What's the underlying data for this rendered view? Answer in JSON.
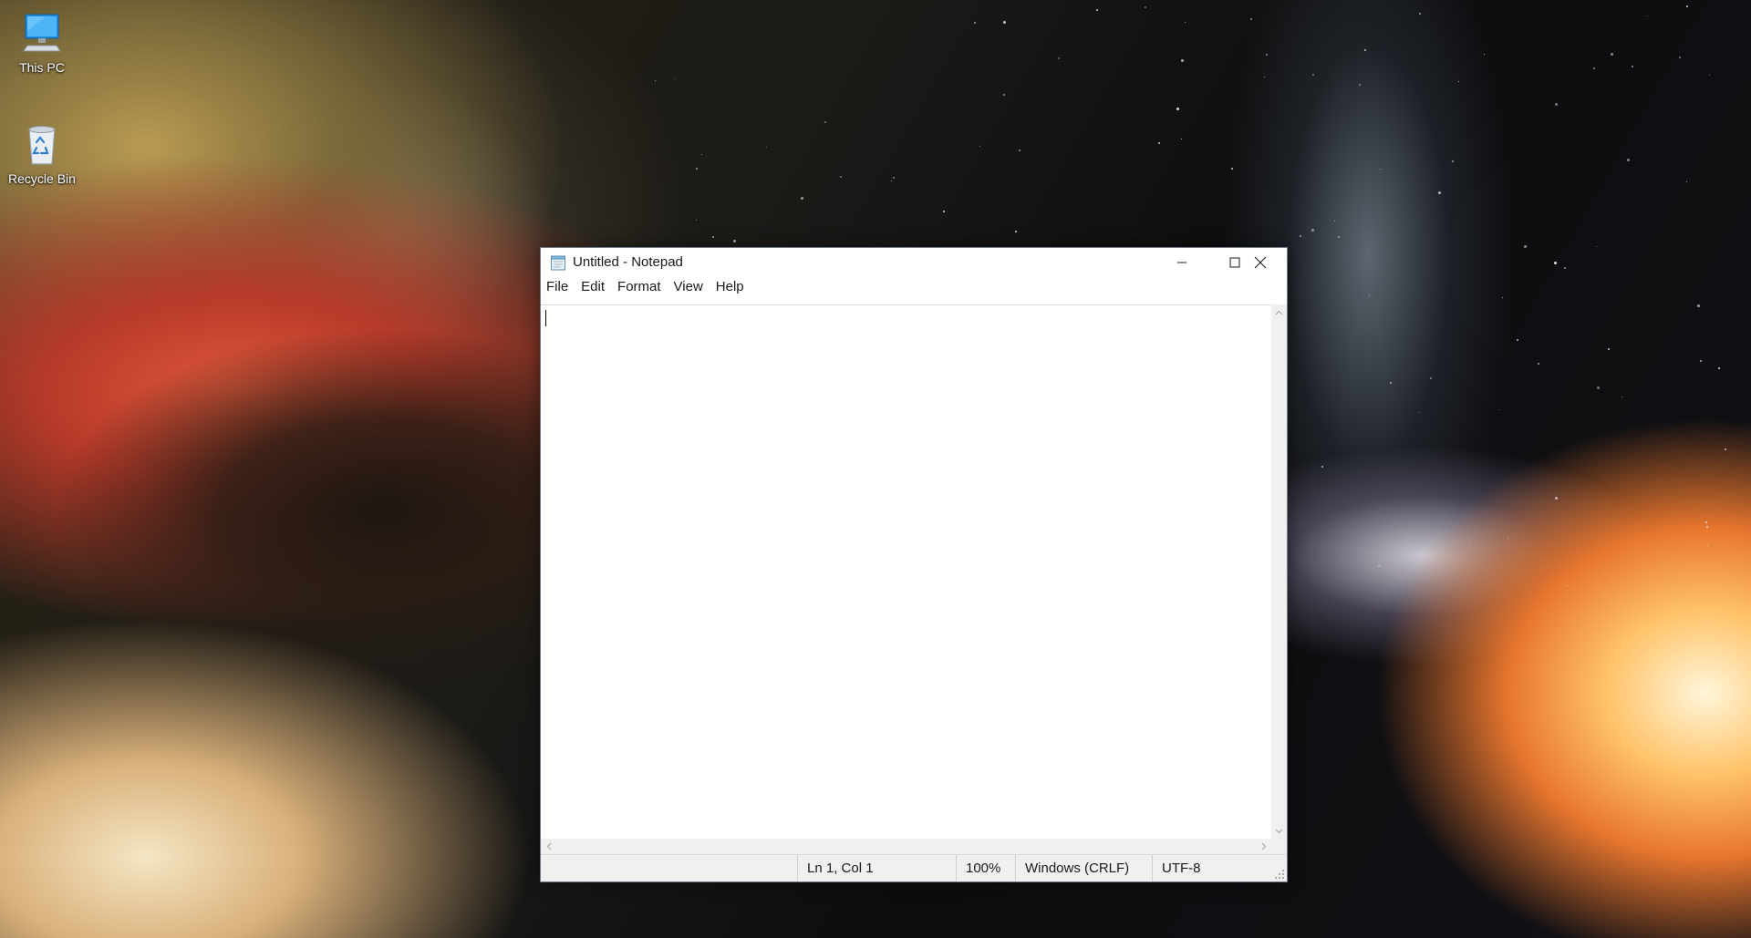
{
  "desktop": {
    "icons": [
      {
        "label": "This PC",
        "icon": "this-pc-icon"
      },
      {
        "label": "Recycle Bin",
        "icon": "recycle-bin-icon"
      }
    ]
  },
  "window": {
    "title": "Untitled - Notepad",
    "app_icon": "notepad-icon",
    "controls": {
      "minimize": "minimize-icon",
      "maximize": "maximize-icon",
      "close": "close-icon"
    }
  },
  "menu": {
    "items": [
      "File",
      "Edit",
      "Format",
      "View",
      "Help"
    ]
  },
  "editor": {
    "content": ""
  },
  "status": {
    "position": "Ln 1, Col 1",
    "zoom": "100%",
    "line_ending": "Windows (CRLF)",
    "encoding": "UTF-8"
  },
  "colors": {
    "window_bg": "#ffffff",
    "statusbar_bg": "#f0f0f0",
    "text": "#1a1a1a"
  }
}
